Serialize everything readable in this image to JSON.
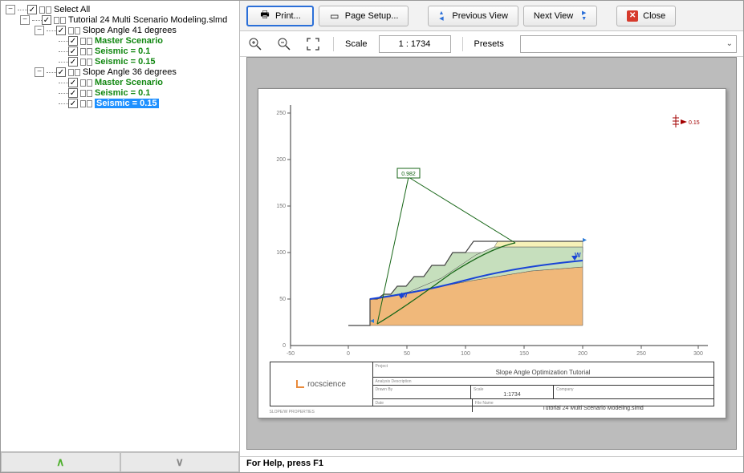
{
  "tree": {
    "root": {
      "label": "Select All"
    },
    "file": {
      "label": "Tutorial 24 Multi Scenario Modeling.slmd"
    },
    "group1": {
      "label": "Slope Angle 41 degrees"
    },
    "g1_master": {
      "label": "Master Scenario"
    },
    "g1_s1": {
      "label": "Seismic = 0.1"
    },
    "g1_s2": {
      "label": "Seismic = 0.15"
    },
    "group2": {
      "label": "Slope Angle 36 degrees"
    },
    "g2_master": {
      "label": "Master Scenario"
    },
    "g2_s1": {
      "label": "Seismic = 0.1"
    },
    "g2_s2": {
      "label": "Seismic = 0.15"
    }
  },
  "toolbar": {
    "print": "Print...",
    "page_setup": "Page Setup...",
    "previous": "Previous View",
    "next": "Next View",
    "close": "Close"
  },
  "zoom": {
    "scale_label": "Scale",
    "scale_value": "1 : 1734",
    "presets_label": "Presets"
  },
  "footer": {
    "up": "⌃",
    "down": "⌄"
  },
  "titleblock": {
    "logo_text": "rocscience",
    "project_label": "Project",
    "project_value": "Slope Angle Optimization Tutorial",
    "analysis_label": "Analysis Description",
    "drawn_label": "Drawn By",
    "scale_label": "Scale",
    "scale_value": "1:1734",
    "company_label": "Company",
    "date_label": "Date",
    "file_label": "File Name",
    "file_value": "Tutorial 24 Multi Scenario Modeling.slmd",
    "stamp": "SLOPE/W PROPERTIES"
  },
  "chart_data": {
    "type": "engineering-section",
    "title": "Slope Angle Optimization Tutorial",
    "xlabel": "",
    "ylabel": "",
    "x_ticks": [
      -50,
      0,
      50,
      100,
      150,
      200,
      250,
      300
    ],
    "y_ticks": [
      0,
      50,
      100,
      150,
      200,
      250
    ],
    "factor_of_safety": 0.982,
    "seismic_coefficient": 0.15,
    "water_table_label": "W",
    "ground_line": [
      [
        0,
        50
      ],
      [
        20,
        50
      ],
      [
        25,
        55
      ],
      [
        30,
        55
      ],
      [
        35,
        62
      ],
      [
        40,
        62
      ],
      [
        48,
        72
      ],
      [
        55,
        72
      ],
      [
        63,
        85
      ],
      [
        75,
        85
      ],
      [
        83,
        100
      ],
      [
        95,
        100
      ],
      [
        200,
        100
      ]
    ],
    "water_table": [
      [
        20,
        50
      ],
      [
        55,
        55
      ],
      [
        100,
        72
      ],
      [
        160,
        82
      ],
      [
        200,
        85
      ]
    ],
    "slip_circle_apex": [
      115,
      175
    ],
    "slip_circle_left": [
      24,
      50
    ],
    "slip_circle_right": [
      155,
      100
    ],
    "layers": [
      {
        "name": "layer-1-green",
        "color": "#c6dfbd"
      },
      {
        "name": "layer-2-yellow",
        "color": "#f6f1b8"
      },
      {
        "name": "layer-3-orange",
        "color": "#f0b87a"
      }
    ]
  },
  "status": {
    "text": "For Help, press F1"
  }
}
